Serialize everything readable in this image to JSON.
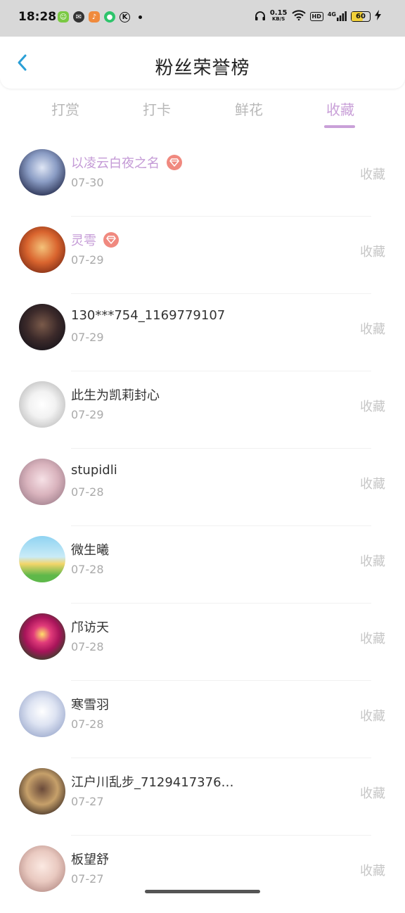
{
  "status_bar": {
    "time": "18:28",
    "speed_value": "0.15",
    "speed_unit": "KB/S",
    "network": "4G",
    "hd_label": "HD",
    "battery": "60",
    "battery_level": 0.6
  },
  "header": {
    "title": "粉丝荣誉榜"
  },
  "tabs": [
    {
      "label": "打赏",
      "active": false
    },
    {
      "label": "打卡",
      "active": false
    },
    {
      "label": "鲜花",
      "active": false
    },
    {
      "label": "收藏",
      "active": true
    }
  ],
  "colors": {
    "accent": "#c9a0d8",
    "badge": "#f0897f",
    "back_arrow": "#2a9fd6"
  },
  "fans": [
    {
      "name": "以凌云白夜之名",
      "date": "07-30",
      "action": "收藏",
      "vip": true
    },
    {
      "name": "灵雩",
      "date": "07-29",
      "action": "收藏",
      "vip": true
    },
    {
      "name": "130***754_1169779107",
      "date": "07-29",
      "action": "收藏",
      "vip": false
    },
    {
      "name": "此生为凯莉封心",
      "date": "07-29",
      "action": "收藏",
      "vip": false
    },
    {
      "name": "stupidli",
      "date": "07-28",
      "action": "收藏",
      "vip": false
    },
    {
      "name": "微生曦",
      "date": "07-28",
      "action": "收藏",
      "vip": false
    },
    {
      "name": "邝访天",
      "date": "07-28",
      "action": "收藏",
      "vip": false
    },
    {
      "name": "寒雪羽",
      "date": "07-28",
      "action": "收藏",
      "vip": false
    },
    {
      "name": "江户川乱步_7129417376…",
      "date": "07-27",
      "action": "收藏",
      "vip": false
    },
    {
      "name": "板望舒",
      "date": "07-27",
      "action": "收藏",
      "vip": false
    }
  ]
}
